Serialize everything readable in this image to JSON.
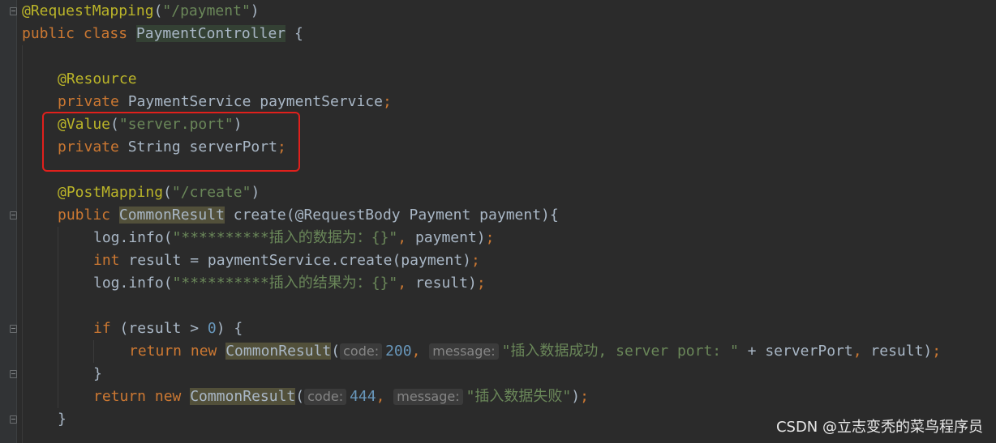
{
  "lines": {
    "l1": {
      "ann": "@RequestMapping",
      "open": "(",
      "str": "\"/payment\"",
      "close": ")"
    },
    "l2": {
      "kw": "public class ",
      "cls": "PaymentController",
      "rest": " {"
    },
    "l4": {
      "ann": "@Resource"
    },
    "l5": {
      "kw": "private ",
      "rest": "PaymentService paymentService",
      "semi": ";"
    },
    "l6": {
      "ann": "@Value",
      "open": "(",
      "str": "\"server.port\"",
      "close": ")"
    },
    "l7": {
      "kw": "private ",
      "rest": "String serverPort",
      "semi": ";"
    },
    "l9": {
      "ann": "@PostMapping",
      "open": "(",
      "str": "\"/create\"",
      "close": ")"
    },
    "l10": {
      "kw": "public ",
      "cls": "CommonResult",
      "rest": " create(@RequestBody Payment payment){"
    },
    "l11": {
      "pre": "log.info(",
      "str": "\"**********插入的数据为：{}\"",
      "comma": ",",
      "rest": " payment)",
      "semi": ";"
    },
    "l12": {
      "kw": "int ",
      "rest": "result = paymentService.create(payment)",
      "semi": ";"
    },
    "l13": {
      "pre": "log.info(",
      "str": "\"**********插入的结果为：{}\"",
      "comma": ",",
      "rest": " result)",
      "semi": ";"
    },
    "l15": {
      "kw": "if ",
      "pre": "(result > ",
      "num": "0",
      "rest": ") {"
    },
    "l16": {
      "kw": "return new ",
      "cls": "CommonResult",
      "open": "(",
      "hint1": "code:",
      "num": "200",
      "comma1": ",",
      "hint2": "message:",
      "str": "\"插入数据成功, server port: \"",
      "rest": " + serverPort",
      "comma2": ",",
      "rest2": " result)",
      "semi": ";"
    },
    "l17": {
      "rest": "}"
    },
    "l18": {
      "kw": "return new ",
      "cls": "CommonResult",
      "open": "(",
      "hint1": "code:",
      "num": "444",
      "comma1": ",",
      "hint2": "message:",
      "str": "\"插入数据失败\"",
      "close": ")",
      "semi": ";"
    },
    "l19": {
      "rest": "}"
    }
  },
  "watermark": "CSDN @立志变秃的菜鸟程序员",
  "colors": {
    "background": "#2b2b2b",
    "keyword": "#cc7832",
    "annotation": "#bbb529",
    "string": "#6a8759",
    "number": "#6897bb",
    "text": "#a9b7c6",
    "highlight_box": "#e0201c"
  }
}
